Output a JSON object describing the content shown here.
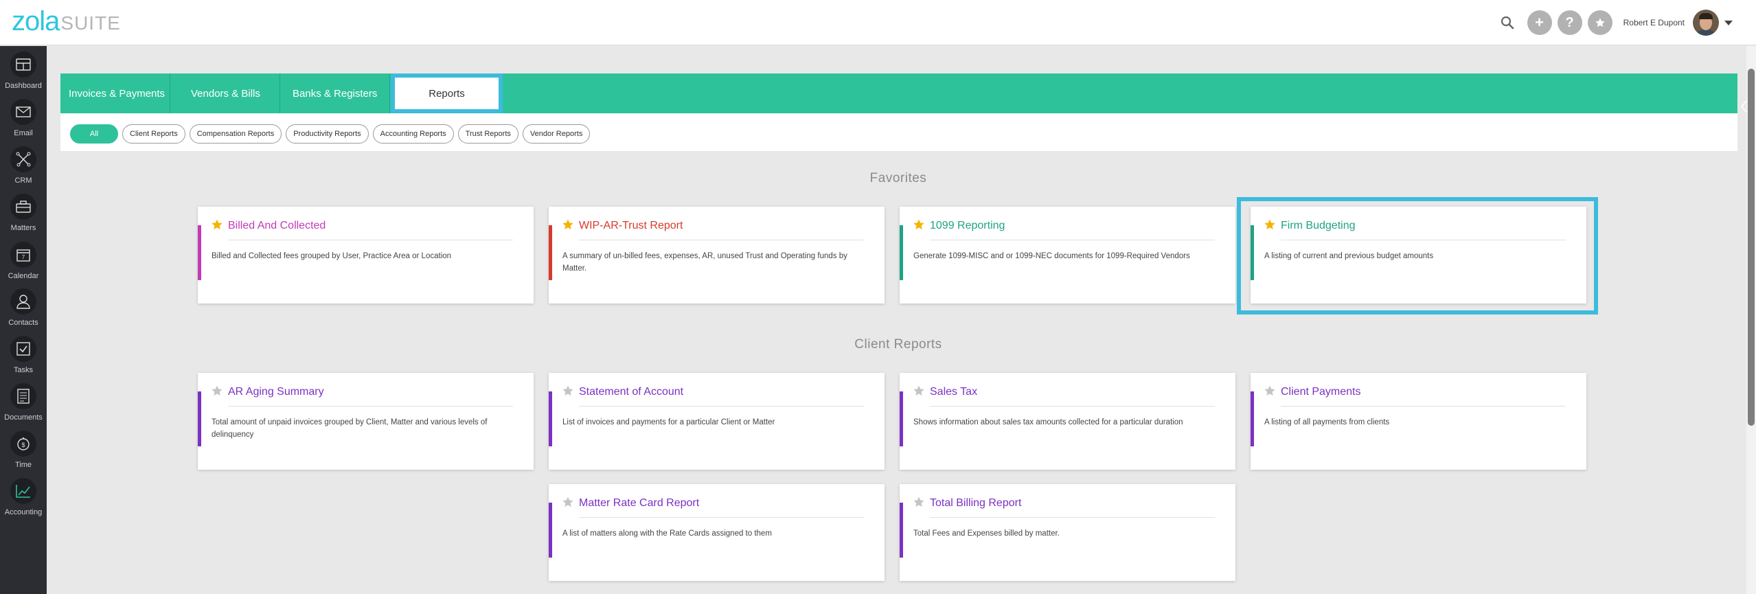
{
  "header": {
    "logo_main": "zola",
    "logo_suffix": "SUITE",
    "user_name": "Robert E Dupont",
    "add_symbol": "+",
    "help_symbol": "?",
    "icons": [
      "search-icon",
      "plus-icon",
      "help-icon",
      "star-icon",
      "avatar",
      "caret-down-icon"
    ]
  },
  "sidebar": {
    "items": [
      {
        "label": "Dashboard",
        "icon": "dashboard-icon"
      },
      {
        "label": "Email",
        "icon": "envelope-icon"
      },
      {
        "label": "CRM",
        "icon": "network-icon"
      },
      {
        "label": "Matters",
        "icon": "briefcase-icon"
      },
      {
        "label": "Calendar",
        "icon": "calendar-icon"
      },
      {
        "label": "Contacts",
        "icon": "user-icon"
      },
      {
        "label": "Tasks",
        "icon": "checkbox-icon"
      },
      {
        "label": "Documents",
        "icon": "document-icon"
      },
      {
        "label": "Time",
        "icon": "stopwatch-icon"
      },
      {
        "label": "Accounting",
        "icon": "chart-icon"
      }
    ]
  },
  "tabs": {
    "items": [
      "Invoices & Payments",
      "Vendors & Bills",
      "Banks & Registers",
      "Reports"
    ],
    "active": "Reports"
  },
  "filters": {
    "items": [
      "All",
      "Client Reports",
      "Compensation Reports",
      "Productivity Reports",
      "Accounting Reports",
      "Trust Reports",
      "Vendor Reports"
    ],
    "active": "All"
  },
  "colors": {
    "teal": "#2ec29b",
    "highlight": "#3dbbdc",
    "star_gold": "#f5b400",
    "star_gray": "#c4c4c4"
  },
  "favorites": {
    "title": "Favorites",
    "cards": [
      {
        "title": "Billed And Collected",
        "desc": "Billed and Collected fees grouped by User, Practice Area or Location",
        "color": "#c23ab8",
        "favorite": true
      },
      {
        "title": "WIP-AR-Trust Report",
        "desc": "A summary of un-billed fees, expenses, AR, unused Trust and Operating funds by Matter.",
        "color": "#d8392b",
        "favorite": true
      },
      {
        "title": "1099 Reporting",
        "desc": "Generate 1099-MISC and or 1099-NEC documents for 1099-Required Vendors",
        "color": "#1fa384",
        "favorite": true
      },
      {
        "title": "Firm Budgeting",
        "desc": "A listing of current and previous budget amounts",
        "color": "#1fa384",
        "favorite": true
      }
    ]
  },
  "client_reports": {
    "title": "Client Reports",
    "cards": [
      {
        "title": "AR Aging Summary",
        "desc": "Total amount of unpaid invoices grouped by Client, Matter and various levels of delinquency",
        "color": "#7b31c4",
        "favorite": false
      },
      {
        "title": "Statement of Account",
        "desc": "List of invoices and payments for a particular Client or Matter",
        "color": "#7b31c4",
        "favorite": false
      },
      {
        "title": "Sales Tax",
        "desc": "Shows information about sales tax amounts collected for a particular duration",
        "color": "#7b31c4",
        "favorite": false
      },
      {
        "title": "Client Payments",
        "desc": "A listing of all payments from clients",
        "color": "#7b31c4",
        "favorite": false
      },
      {
        "title": "Matter Rate Card Report",
        "desc": "A list of matters along with the Rate Cards assigned to them",
        "color": "#7b31c4",
        "favorite": false
      },
      {
        "title": "Total Billing Report",
        "desc": "Total Fees and Expenses billed by matter.",
        "color": "#7b31c4",
        "favorite": false
      }
    ]
  }
}
